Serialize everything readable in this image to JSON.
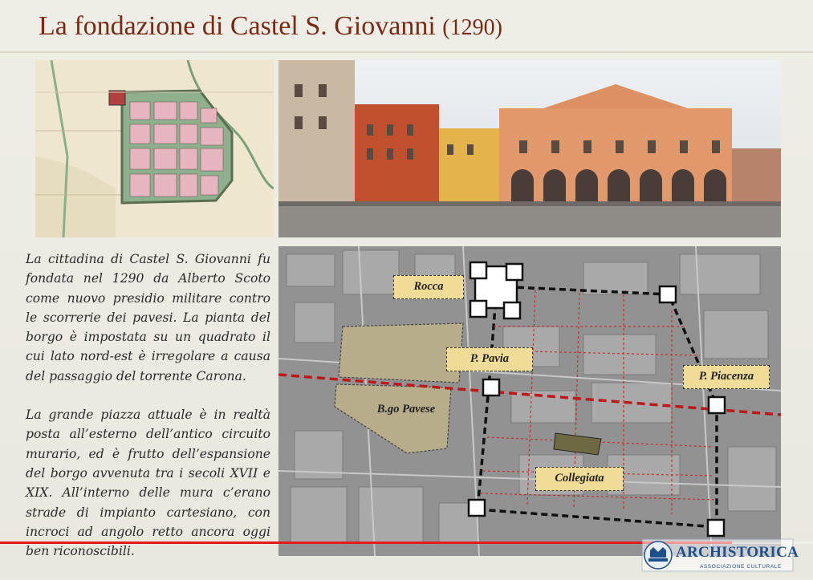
{
  "slide": {
    "title": "La fondazione di Castel S. Giovanni",
    "title_year": "(1290)",
    "paragraphs": [
      "La cittadina di Castel S. Giovanni fu fondata nel 1290 da Alberto Scoto come nuovo presidio militare contro le scorrerie dei pavesi. La pianta del borgo è impostata su un quadrato il cui lato nord-est è irregolare a causa del passaggio del torrente Carona.",
      "La grande piazza attuale è in realtà posta all’esterno dell’antico circuito murario, ed è frutto dell’espansione del borgo avvenuta tra i secoli XVII e XIX. All’interno delle mura c’erano strade di impianto cartesiano, con incroci ad angolo retto ancora oggi ben riconoscibili."
    ],
    "map_labels": {
      "rocca": "Rocca",
      "pavia": "P. Pavia",
      "piacenza": "P. Piacenza",
      "borgo_pavese": "B.go Pavese",
      "collegiata": "Collegiata"
    }
  },
  "logo": {
    "name": "ARCHISTORICA",
    "subtitle": "ASSOCIAZIONE CULTURALE"
  },
  "player": {
    "progress": 0.9
  },
  "colors": {
    "title": "#7a2a14",
    "label_fill": "#f1dc97",
    "progress": "#e31b1b",
    "logo": "#1d4f8c"
  }
}
